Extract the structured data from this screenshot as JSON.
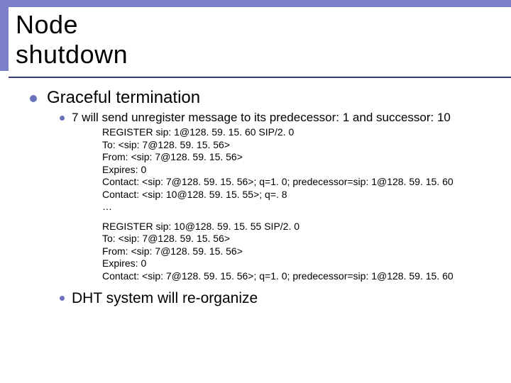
{
  "title": "Node shutdown",
  "point1": "Graceful termination",
  "sub1": "7 will send unregister message to its predecessor: 1 and successor: 10",
  "code1": {
    "l0": "REGISTER sip: 1@128. 59. 15. 60 SIP/2. 0",
    "l1": "To: <sip: 7@128. 59. 15. 56>",
    "l2": "From: <sip: 7@128. 59. 15. 56>",
    "l3": "Expires: 0",
    "l4": "Contact: <sip: 7@128. 59. 15. 56>; q=1. 0; predecessor=sip: 1@128. 59. 15. 60",
    "l5": "Contact: <sip: 10@128. 59. 15. 55>; q=. 8",
    "l6": "…"
  },
  "code2": {
    "l0": "REGISTER sip: 10@128. 59. 15. 55 SIP/2. 0",
    "l1": "To: <sip: 7@128. 59. 15. 56>",
    "l2": "From: <sip: 7@128. 59. 15. 56>",
    "l3": "Expires: 0",
    "l4": "Contact: <sip: 7@128. 59. 15. 56>; q=1. 0; predecessor=sip: 1@128. 59. 15. 60"
  },
  "sub2": "DHT system will re-organize"
}
